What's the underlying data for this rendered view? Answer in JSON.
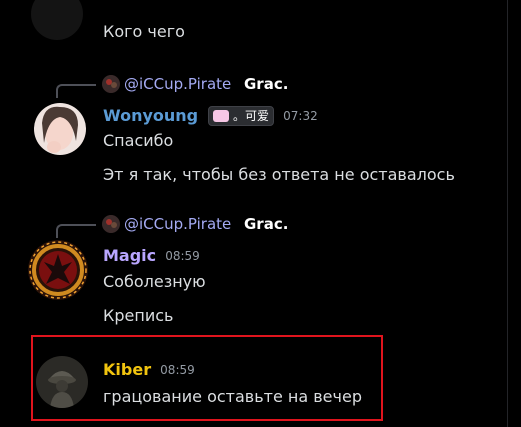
{
  "colors": {
    "background": "#000000",
    "message_text": "#dbdee1",
    "timestamp": "#949ba4",
    "mention": "#a4aaf2",
    "wonyoung_name": "#5b9bd5",
    "magic_name": "#b9a6ff",
    "kiber_name": "#f1c40f",
    "highlight_border": "#e0141d"
  },
  "messages": [
    {
      "text_lines": [
        "Кого чего"
      ]
    },
    {
      "reply": {
        "mention": "@iCCup.Pirate",
        "text": "Grac.",
        "avatar_icon": "pirate-avatar-icon"
      },
      "author": "Wonyoung",
      "role_tag": {
        "icon": "heart-icon",
        "text": "。可爱"
      },
      "time": "07:32",
      "text_lines": [
        "Спасибо",
        "Эт я так, чтобы без ответа не оставалось"
      ]
    },
    {
      "reply": {
        "mention": "@iCCup.Pirate",
        "text": "Grac.",
        "avatar_icon": "pirate-avatar-icon"
      },
      "author": "Magic",
      "time": "08:59",
      "text_lines": [
        "Соболезную",
        "Крепись"
      ]
    },
    {
      "author": "Kiber",
      "time": "08:59",
      "text_lines": [
        "грацование оставьте на вечер"
      ],
      "highlighted": true
    }
  ]
}
